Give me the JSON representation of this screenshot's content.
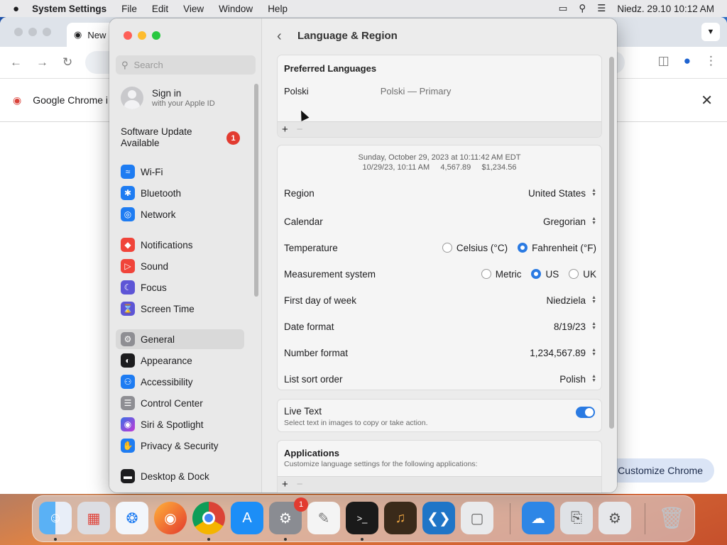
{
  "menubar": {
    "app": "System Settings",
    "items": [
      "File",
      "Edit",
      "View",
      "Window",
      "Help"
    ],
    "clock": "Niedz. 29.10  10:12 AM"
  },
  "chrome": {
    "tab_title": "New",
    "infobar_text": "Google Chrome i",
    "customize_label": "Customize Chrome"
  },
  "sidebar": {
    "search_placeholder": "Search",
    "signin_title": "Sign in",
    "signin_sub": "with your Apple ID",
    "software_update": "Software Update Available",
    "software_update_badge": "1",
    "items": [
      {
        "label": "Wi-Fi",
        "icon": "wifi-icon",
        "color": "#1e7cf2"
      },
      {
        "label": "Bluetooth",
        "icon": "bluetooth-icon",
        "color": "#1e7cf2"
      },
      {
        "label": "Network",
        "icon": "globe-icon",
        "color": "#1e7cf2"
      },
      {
        "label": "Notifications",
        "icon": "bell-icon",
        "color": "#f0443a"
      },
      {
        "label": "Sound",
        "icon": "speaker-icon",
        "color": "#f0443a"
      },
      {
        "label": "Focus",
        "icon": "moon-icon",
        "color": "#5d55d6"
      },
      {
        "label": "Screen Time",
        "icon": "hourglass-icon",
        "color": "#5d55d6"
      },
      {
        "label": "General",
        "icon": "gear-icon",
        "color": "#8e8e93"
      },
      {
        "label": "Appearance",
        "icon": "appearance-icon",
        "color": "#1c1c1e"
      },
      {
        "label": "Accessibility",
        "icon": "accessibility-icon",
        "color": "#1e7cf2"
      },
      {
        "label": "Control Center",
        "icon": "control-center-icon",
        "color": "#8e8e93"
      },
      {
        "label": "Siri & Spotlight",
        "icon": "siri-icon",
        "color": "#b34fd0"
      },
      {
        "label": "Privacy & Security",
        "icon": "hand-icon",
        "color": "#1e7cf2"
      },
      {
        "label": "Desktop & Dock",
        "icon": "dock-icon",
        "color": "#1c1c1e"
      }
    ],
    "selected": "General"
  },
  "main": {
    "title": "Language & Region",
    "preferred_languages": {
      "heading": "Preferred Languages",
      "language": "Polski",
      "detail": "Polski — Primary"
    },
    "preview_line1": "Sunday, October 29, 2023 at 10:11:42 AM EDT",
    "preview_line2": "10/29/23, 10:11 AM     4,567.89     $1,234.56",
    "region": {
      "label": "Region",
      "value": "United States"
    },
    "calendar": {
      "label": "Calendar",
      "value": "Gregorian"
    },
    "temperature": {
      "label": "Temperature",
      "options": [
        "Celsius (°C)",
        "Fahrenheit (°F)"
      ],
      "selected": "Fahrenheit (°F)"
    },
    "measurement": {
      "label": "Measurement system",
      "options": [
        "Metric",
        "US",
        "UK"
      ],
      "selected": "US"
    },
    "first_day": {
      "label": "First day of week",
      "value": "Niedziela"
    },
    "date_format": {
      "label": "Date format",
      "value": "8/19/23"
    },
    "number_format": {
      "label": "Number format",
      "value": "1,234,567.89"
    },
    "sort_order": {
      "label": "List sort order",
      "value": "Polish"
    },
    "live_text": {
      "label": "Live Text",
      "sub": "Select text in images to copy or take action.",
      "enabled": true
    },
    "applications": {
      "heading": "Applications",
      "sub": "Customize language settings for the following applications:"
    }
  },
  "dock": {
    "apps": [
      "Finder",
      "Launchpad",
      "Safari",
      "Firefox",
      "Google Chrome",
      "App Store",
      "System Settings",
      "TextEdit",
      "Terminal",
      "GarageBand",
      "Visual Studio Code",
      "Roblox",
      "Weather",
      "Migration Assistant",
      "System Information",
      "Trash"
    ],
    "settings_badge": "1"
  }
}
